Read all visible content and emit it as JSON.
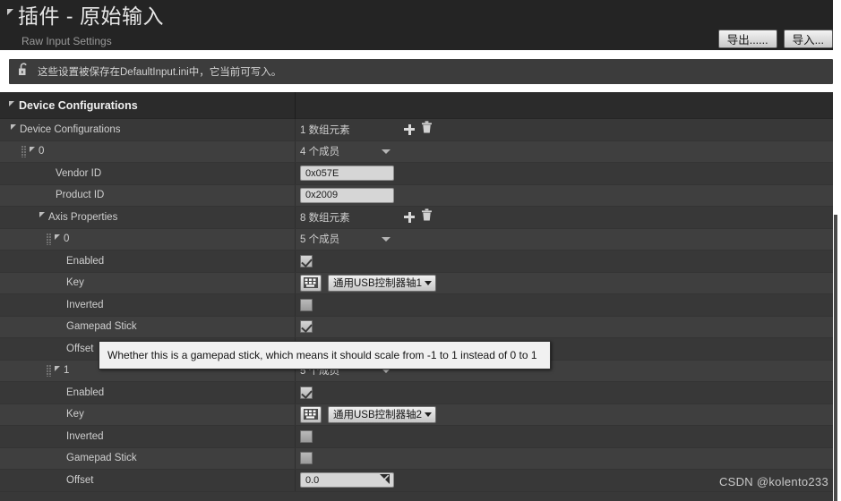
{
  "header": {
    "title": "插件 - 原始输入",
    "subtitle": "Raw Input Settings",
    "export_label": "导出......",
    "import_label": "导入..."
  },
  "info": {
    "message": "这些设置被保存在DefaultInput.ini中，它当前可写入。",
    "icon": "unlock-icon"
  },
  "table": {
    "section_header": "Device Configurations",
    "rows": [
      {
        "name": "Device Configurations",
        "value": "1 数组元素",
        "kind": "array-header",
        "indent": 8
      },
      {
        "name": "0",
        "value": "4 个成员",
        "kind": "struct-header",
        "indent": 20
      },
      {
        "name": "Vendor ID",
        "value": "0x057E",
        "kind": "text",
        "indent": 58
      },
      {
        "name": "Product ID",
        "value": "0x2009",
        "kind": "text",
        "indent": 58
      },
      {
        "name": "Axis Properties",
        "value": "8 数组元素",
        "kind": "array-header",
        "indent": 40
      },
      {
        "name": "0",
        "value": "5 个成员",
        "kind": "struct-header",
        "indent": 48
      },
      {
        "name": "Enabled",
        "value": "checked",
        "kind": "checkbox",
        "indent": 70
      },
      {
        "name": "Key",
        "value": "通用USB控制器轴1",
        "kind": "key",
        "indent": 70
      },
      {
        "name": "Inverted",
        "value": "unchecked",
        "kind": "checkbox",
        "indent": 70
      },
      {
        "name": "Gamepad Stick",
        "value": "checked",
        "kind": "checkbox",
        "indent": 70
      },
      {
        "name": "Offset",
        "value": "",
        "kind": "hidden-value",
        "indent": 70
      },
      {
        "name": "1",
        "value": "5 个成员",
        "kind": "struct-header",
        "indent": 48
      },
      {
        "name": "Enabled",
        "value": "checked",
        "kind": "checkbox",
        "indent": 70
      },
      {
        "name": "Key",
        "value": "通用USB控制器轴2",
        "kind": "key",
        "indent": 70
      },
      {
        "name": "Inverted",
        "value": "unchecked",
        "kind": "checkbox",
        "indent": 70
      },
      {
        "name": "Gamepad Stick",
        "value": "unchecked",
        "kind": "checkbox",
        "indent": 70
      },
      {
        "name": "Offset",
        "value": "0.0",
        "kind": "number",
        "indent": 70
      }
    ]
  },
  "tooltip": {
    "text": "Whether this is a gamepad stick, which means it should scale from -1 to 1 instead of 0 to 1"
  },
  "watermark": {
    "text": "CSDN @kolento233"
  },
  "colors": {
    "window_bg": "#242424",
    "panel_bg": "#383838",
    "row_alt": "#3f3f3f",
    "header_bg": "#2b2b2b",
    "text": "#cfcfcf"
  }
}
